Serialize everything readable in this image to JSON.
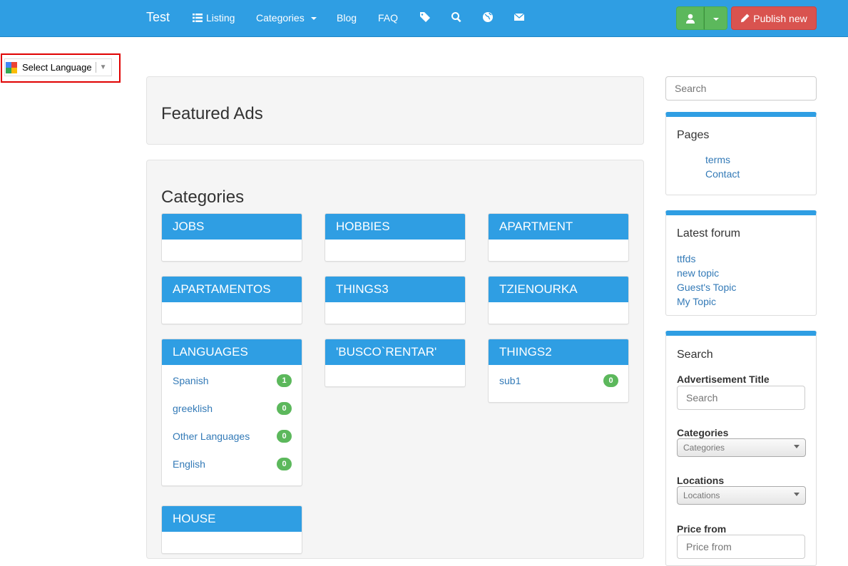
{
  "nav": {
    "brand": "Test",
    "listing": "Listing",
    "categories": "Categories",
    "blog": "Blog",
    "faq": "FAQ",
    "publish": "Publish new"
  },
  "language": {
    "label": "Select Language",
    "arrow": "▼"
  },
  "featured": {
    "title": "Featured Ads"
  },
  "categories_section": {
    "title": "Categories",
    "cards": [
      {
        "name": "JOBS",
        "subs": []
      },
      {
        "name": "HOBBIES",
        "subs": []
      },
      {
        "name": "APARTMENT",
        "subs": []
      },
      {
        "name": "APARTAMENTOS",
        "subs": []
      },
      {
        "name": "THINGS3",
        "subs": []
      },
      {
        "name": "TZIENOURKA",
        "subs": []
      },
      {
        "name": "LANGUAGES",
        "subs": [
          {
            "label": "Spanish",
            "count": "1"
          },
          {
            "label": "greeklish",
            "count": "0"
          },
          {
            "label": "Other Languages",
            "count": "0"
          },
          {
            "label": "English",
            "count": "0"
          }
        ]
      },
      {
        "name": "'BUSCO`RENTAR'",
        "subs": []
      },
      {
        "name": "THINGS2",
        "subs": [
          {
            "label": "sub1",
            "count": "0"
          }
        ]
      },
      {
        "name": "HOUSE",
        "subs": []
      }
    ]
  },
  "sidebar": {
    "search_placeholder": "Search",
    "pages": {
      "title": "Pages",
      "links": [
        "terms",
        "Contact"
      ]
    },
    "forum": {
      "title": "Latest forum",
      "links": [
        "ttfds",
        "new topic",
        "Guest's Topic",
        "My Topic"
      ]
    },
    "search_form": {
      "title": "Search",
      "ad_title_label": "Advertisement Title",
      "ad_title_placeholder": "Search",
      "categories_label": "Categories",
      "categories_value": "Categories",
      "locations_label": "Locations",
      "locations_value": "Locations",
      "price_from_label": "Price from",
      "price_from_placeholder": "Price from"
    }
  },
  "colors": {
    "primary": "#2f9ee3",
    "success": "#5cb85c",
    "danger": "#d9534f"
  }
}
